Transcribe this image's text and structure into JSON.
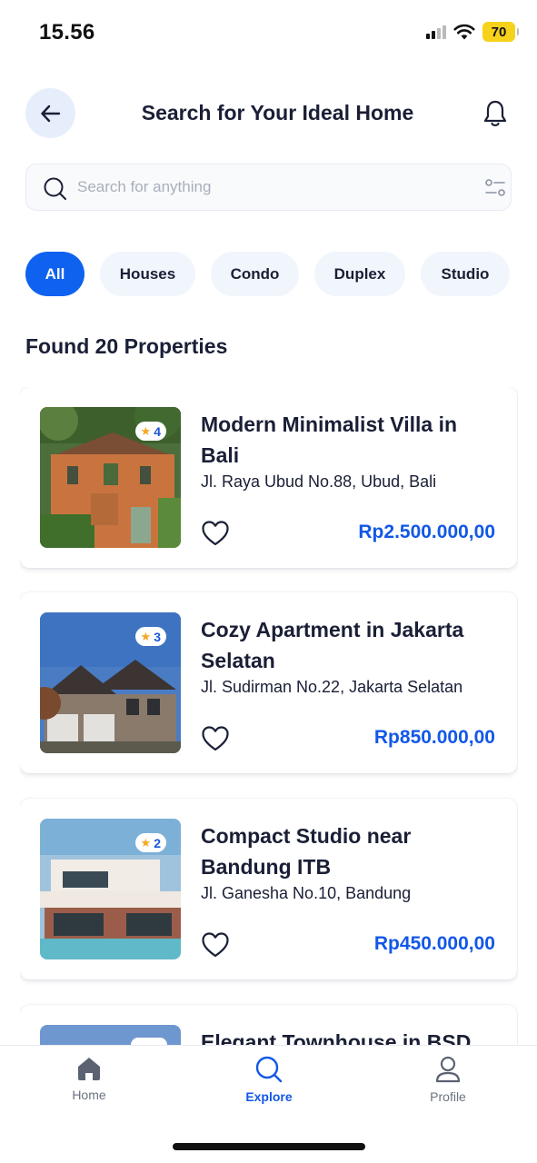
{
  "status_bar": {
    "time": "15.56",
    "battery": "70"
  },
  "header": {
    "title": "Search for Your Ideal Home"
  },
  "search": {
    "placeholder": "Search for anything"
  },
  "categories": [
    {
      "label": "All",
      "active": true
    },
    {
      "label": "Houses",
      "active": false
    },
    {
      "label": "Condo",
      "active": false
    },
    {
      "label": "Duplex",
      "active": false
    },
    {
      "label": "Studio",
      "active": false
    }
  ],
  "results": {
    "title": "Found 20 Properties"
  },
  "properties": [
    {
      "rating": "4",
      "title": "Modern Minimalist Villa in Bali",
      "address": "Jl. Raya Ubud No.88, Ubud, Bali",
      "price": "Rp2.500.000,00"
    },
    {
      "rating": "3",
      "title": "Cozy Apartment in Jakarta Selatan",
      "address": "Jl. Sudirman No.22, Jakarta Selatan",
      "price": "Rp850.000,00"
    },
    {
      "rating": "2",
      "title": "Compact Studio near Bandung ITB",
      "address": "Jl. Ganesha No.10, Bandung",
      "price": "Rp450.000,00"
    },
    {
      "rating": "",
      "title": "Elegant Townhouse in BSD",
      "address": "",
      "price": ""
    }
  ],
  "nav": [
    {
      "label": "Home",
      "icon": "home-icon",
      "active": false
    },
    {
      "label": "Explore",
      "icon": "search-icon",
      "active": true
    },
    {
      "label": "Profile",
      "icon": "user-icon",
      "active": false
    }
  ],
  "colors": {
    "accent": "#0f62f0",
    "price": "#1258e6",
    "text": "#1a1f36",
    "star": "#f5a623"
  }
}
